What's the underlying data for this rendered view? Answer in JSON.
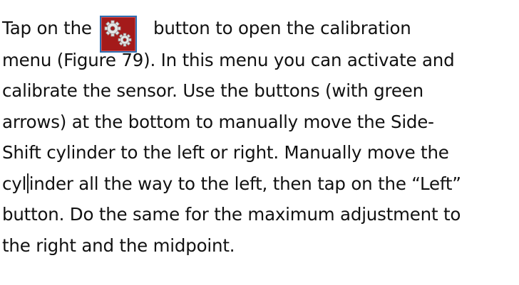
{
  "paragraph": {
    "line1_before": "Tap on the",
    "line1_after": "button to open the calibration",
    "line2": "menu (Figure 79). In this menu you can activate and",
    "line3": "calibrate the sensor. Use the buttons (with green",
    "line4": "arrows) at the bottom to manually move the Side-",
    "line5": "Shift cylinder to the left or right. Manually move the",
    "line6_part1": "cyl",
    "line6_part2": "inder all the way to the left, then tap on the “Left”",
    "line7": "button. Do the same for the maximum adjustment to",
    "line8": "the right and the midpoint."
  },
  "icons": {
    "settings_button": "gears-icon"
  },
  "colors": {
    "button_fill": "#a41a1a",
    "button_border": "#2d6fb2"
  }
}
